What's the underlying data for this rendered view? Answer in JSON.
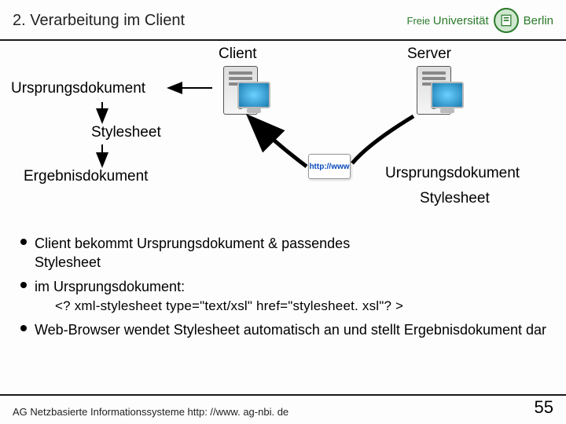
{
  "header": {
    "title": "2. Verarbeitung im Client",
    "uni_prefix": "Freie",
    "uni_main": "Universität",
    "uni_city": "Berlin"
  },
  "diagram": {
    "client_label": "Client",
    "server_label": "Server",
    "left_doc1": "Ursprungsdokument",
    "left_style": "Stylesheet",
    "left_result": "Ergebnisdokument",
    "right_doc1": "Ursprungsdokument",
    "right_style": "Stylesheet",
    "http": "http://www"
  },
  "bullets": {
    "b1a": "Client bekommt Ursprungsdokument & passendes",
    "b1b": "Stylesheet",
    "b2": "im Ursprungsdokument:",
    "code": "<? xml-stylesheet type=\"text/xsl\" href=\"stylesheet. xsl\"? >",
    "b3": "Web-Browser wendet Stylesheet automatisch an und stellt Ergebnisdokument dar"
  },
  "footer": {
    "left": "AG Netzbasierte Informationssysteme http: //www. ag-nbi. de",
    "page": "55"
  }
}
